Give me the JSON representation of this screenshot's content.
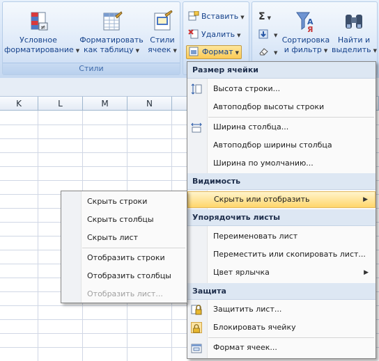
{
  "ribbon": {
    "styles_group": {
      "label": "Стили",
      "conditional_line1": "Условное",
      "conditional_line2": "форматирование",
      "format_table_line1": "Форматировать",
      "format_table_line2": "как таблицу",
      "cell_styles_line1": "Стили",
      "cell_styles_line2": "ячеек"
    },
    "cells_group": {
      "insert": "Вставить",
      "delete": "Удалить",
      "format": "Формат"
    },
    "editing_group": {
      "sigma": "Σ",
      "sort_line1": "Сортировка",
      "sort_line2": "и фильтр",
      "find_line1": "Найти и",
      "find_line2": "выделить"
    }
  },
  "sheet": {
    "columns": [
      "K",
      "L",
      "M",
      "N"
    ]
  },
  "format_menu": {
    "header_cell_size": "Размер ячейки",
    "row_height": "Высота строки...",
    "autofit_row": "Автоподбор высоты строки",
    "column_width": "Ширина столбца...",
    "autofit_column": "Автоподбор ширины столбца",
    "default_width": "Ширина по умолчанию...",
    "header_visibility": "Видимость",
    "hide_unhide": "Скрыть или отобразить",
    "header_organize": "Упорядочить листы",
    "rename_sheet": "Переименовать лист",
    "move_copy_sheet": "Переместить или скопировать лист...",
    "tab_color": "Цвет ярлычка",
    "header_protection": "Защита",
    "protect_sheet": "Защитить лист...",
    "lock_cell": "Блокировать ячейку",
    "format_cells": "Формат ячеек..."
  },
  "hide_submenu": {
    "hide_rows": "Скрыть строки",
    "hide_columns": "Скрыть столбцы",
    "hide_sheet": "Скрыть лист",
    "show_rows": "Отобразить строки",
    "show_columns": "Отобразить столбцы",
    "show_sheet": "Отобразить лист..."
  },
  "colors": {
    "highlight": "#ffd66b",
    "ribbon_text": "#15428b"
  }
}
